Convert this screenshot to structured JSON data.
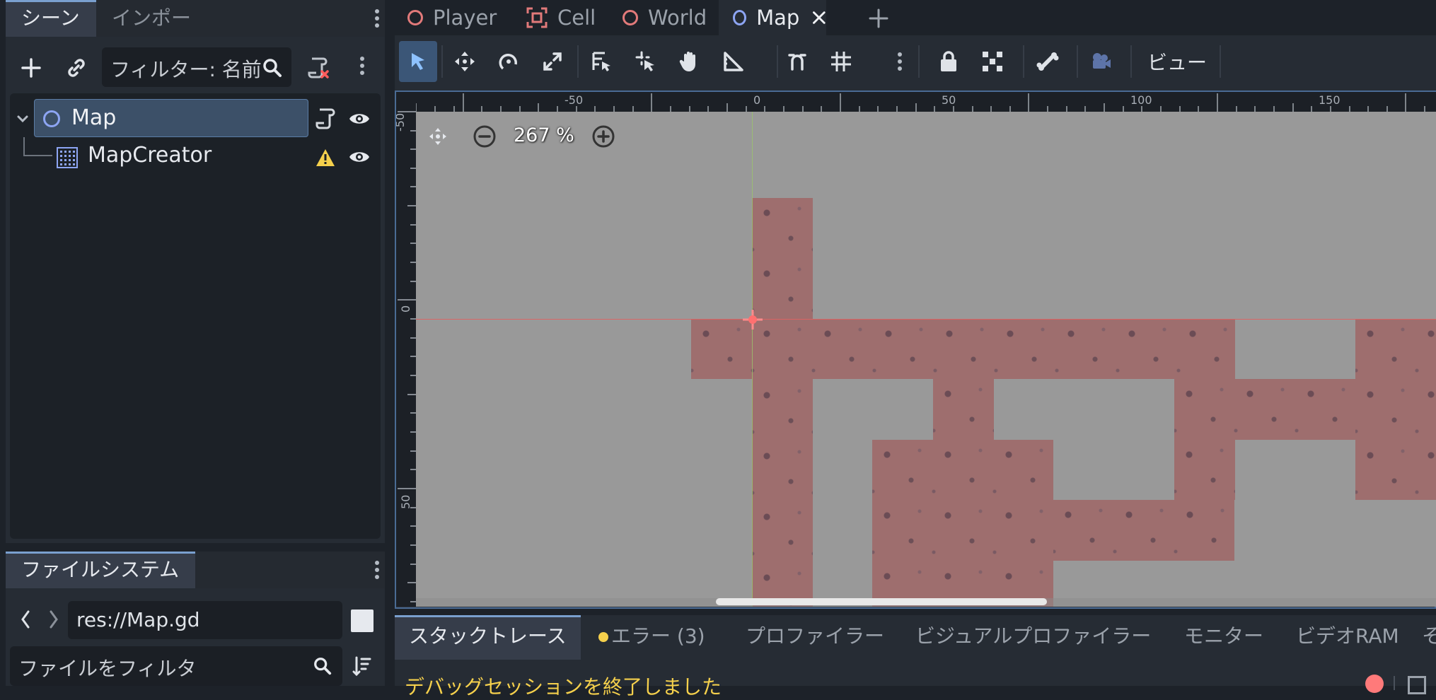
{
  "left_dock": {
    "tabs": [
      "シーン",
      "インポート"
    ],
    "scene_filter_placeholder": "フィルター: 名前",
    "tree": [
      {
        "label": "Map"
      },
      {
        "label": "MapCreator"
      }
    ],
    "filesystem_tab": "ファイルシステム",
    "path": "res://Map.gd",
    "file_filter_placeholder": "ファイルをフィルタ"
  },
  "editor_tabs": [
    {
      "label": "Player",
      "color": "#e27a7a"
    },
    {
      "label": "Cell",
      "color": "#e27a7a"
    },
    {
      "label": "World",
      "color": "#e27a7a"
    },
    {
      "label": "Map",
      "color": "#8da5f3"
    }
  ],
  "toolbar": {
    "view_menu": "ビュー"
  },
  "viewport": {
    "zoom": "267 %",
    "ruler_top": [
      "-50",
      "0",
      "50",
      "100",
      "150"
    ],
    "ruler_left": [
      "-50",
      "0",
      "50"
    ]
  },
  "bottom_panel": {
    "tabs": [
      "スタックトレース",
      "エラー (3)",
      "プロファイラー",
      "ビジュアルプロファイラー",
      "モニター",
      "ビデオRAM",
      "そ"
    ],
    "message": "デバッグセッションを終了しました"
  },
  "colors": {
    "accent": "#7aa0cf",
    "tile": "#9e6e6e",
    "warning": "#f5d04c",
    "record": "#ff7a7a"
  }
}
